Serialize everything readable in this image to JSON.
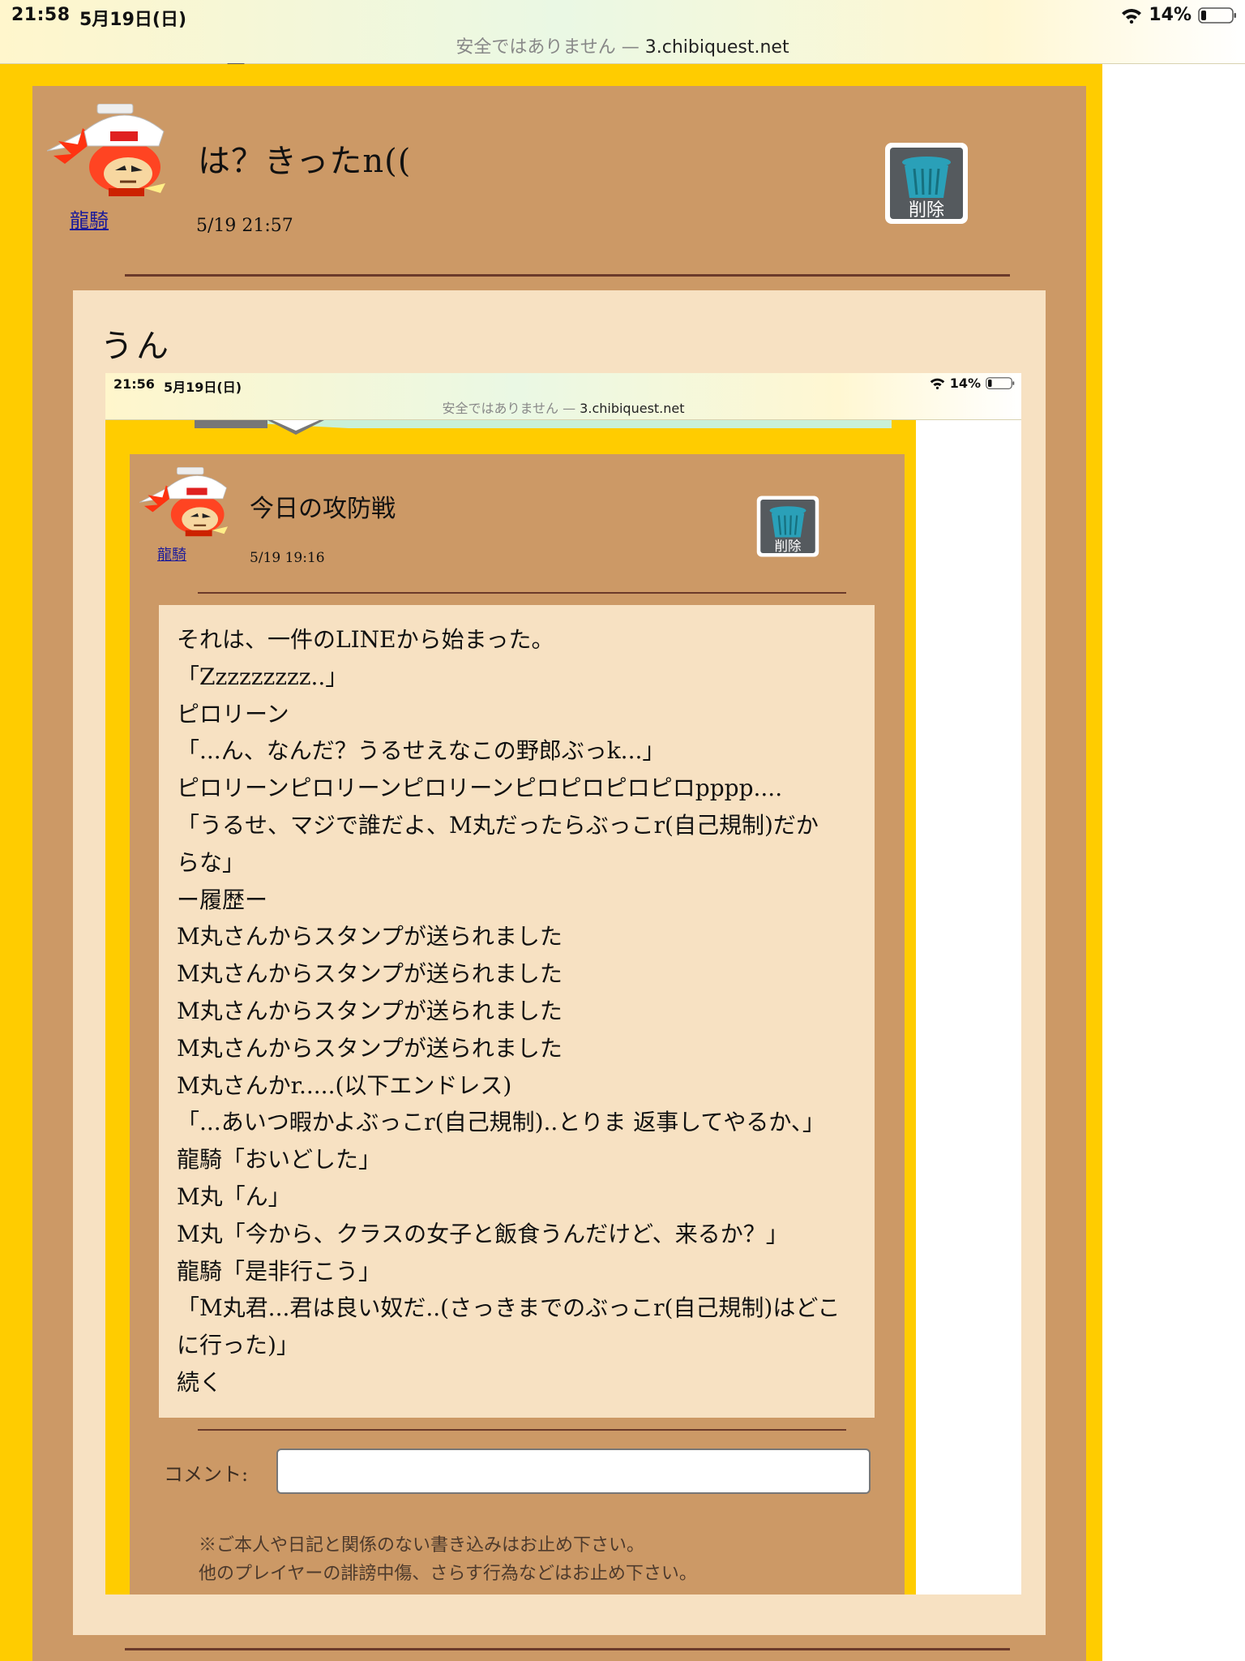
{
  "status_bar": {
    "time": "21:58",
    "date": "5月19日(日)",
    "battery": "14%",
    "security_text": "安全ではありません —",
    "host": "3.chibiquest.net"
  },
  "post": {
    "author": "龍騎",
    "title": "は？きったn((",
    "date": "5/19 21:57",
    "delete_label": "削除",
    "body": "うん"
  },
  "embedded_screenshot": {
    "status_bar": {
      "time": "21:56",
      "date": "5月19日(日)",
      "battery": "14%",
      "security_text": "安全ではありません —",
      "host": "3.chibiquest.net"
    },
    "post": {
      "author": "龍騎",
      "title": "今日の攻防戦",
      "date": "5/19 19:16",
      "delete_label": "削除",
      "lines": [
        "それは、一件のLINEから始まった。",
        "「Zzzzzzzzz..」",
        "ピロリーン",
        "「...ん、なんだ？うるせえなこの野郎ぶっk...」",
        "ピロリーンピロリーンピロリーンピロピロピロピロpppp....",
        "「うるせ、マジで誰だよ、M丸だったらぶっこr(自己規制)だか",
        "らな」",
        "ー履歴ー",
        "M丸さんからスタンプが送られました",
        "M丸さんからスタンプが送られました",
        "M丸さんからスタンプが送られました",
        "M丸さんからスタンプが送られました",
        "M丸さんかr.....(以下エンドレス)",
        "「...あいつ暇かよぶっこr(自己規制)..とりま 返事してやるか、」",
        "龍騎「おいどした」",
        "M丸「ん」",
        "M丸「今から、クラスの女子と飯食うんだけど、来るか？」",
        "龍騎「是非行こう」",
        "「M丸君...君は良い奴だ..(さっきまでのぶっこr(自己規制)はどこ",
        "に行った)」",
        "続く"
      ]
    },
    "comment_label": "コメント:",
    "comment_value": "",
    "notes": [
      "※ご本人や日記と関係のない書き込みはお止め下さい。",
      "他のプレイヤーの誹謗中傷、さらす行為などはお止め下さい。"
    ]
  },
  "colors": {
    "yellow_bg": "#ffcc00",
    "tan_bg": "#cc9966",
    "cream_bg": "#f7e1c2",
    "divider": "#6b3a2a",
    "link": "#1a1a9a"
  }
}
